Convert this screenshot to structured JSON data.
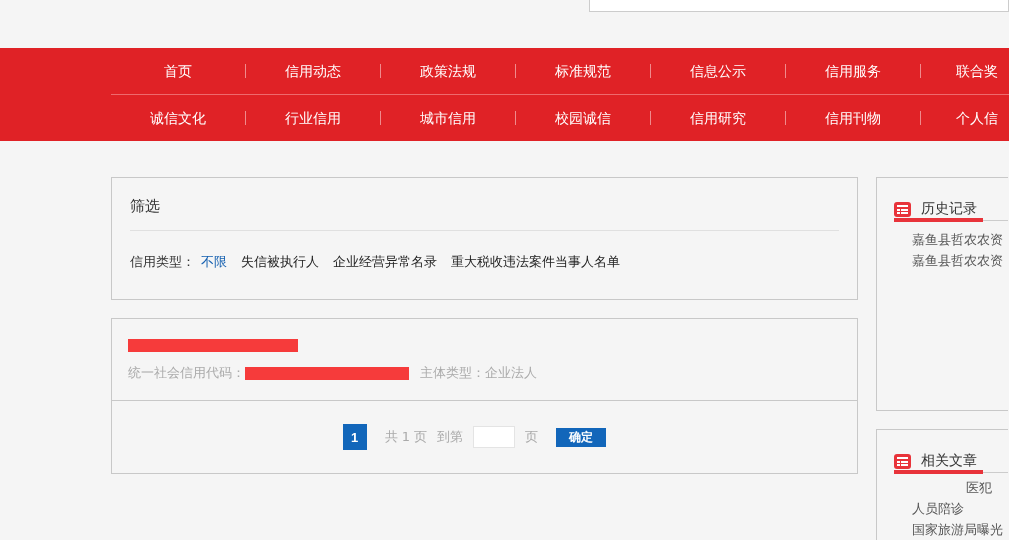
{
  "nav_rows": [
    [
      "首页",
      "信用动态",
      "政策法规",
      "标准规范",
      "信息公示",
      "信用服务",
      "联合奖"
    ],
    [
      "诚信文化",
      "行业信用",
      "城市信用",
      "校园诚信",
      "信用研究",
      "信用刊物",
      "个人信"
    ]
  ],
  "filter": {
    "title": "筛选",
    "label": "信用类型：",
    "options": [
      {
        "label": "不限",
        "selected": true
      },
      {
        "label": "失信被执行人",
        "selected": false
      },
      {
        "label": "企业经营异常名录",
        "selected": false
      },
      {
        "label": "重大税收违法案件当事人名单",
        "selected": false
      }
    ]
  },
  "result": {
    "code_label": "统一社会信用代码：",
    "type_label": "主体类型：企业法人"
  },
  "pagination": {
    "pages": [
      {
        "label": "1",
        "selected": true
      }
    ],
    "total": "共 1 页",
    "goto": "到第",
    "unit": "页",
    "confirm": "确定"
  },
  "sidebar": [
    {
      "title": "历史记录",
      "items": [
        "嘉鱼县哲农农资",
        "嘉鱼县哲农农资"
      ]
    },
    {
      "title": "相关文章",
      "items": [
        "医犯",
        "人员陪诊",
        "国家旅游局曝光"
      ]
    }
  ]
}
